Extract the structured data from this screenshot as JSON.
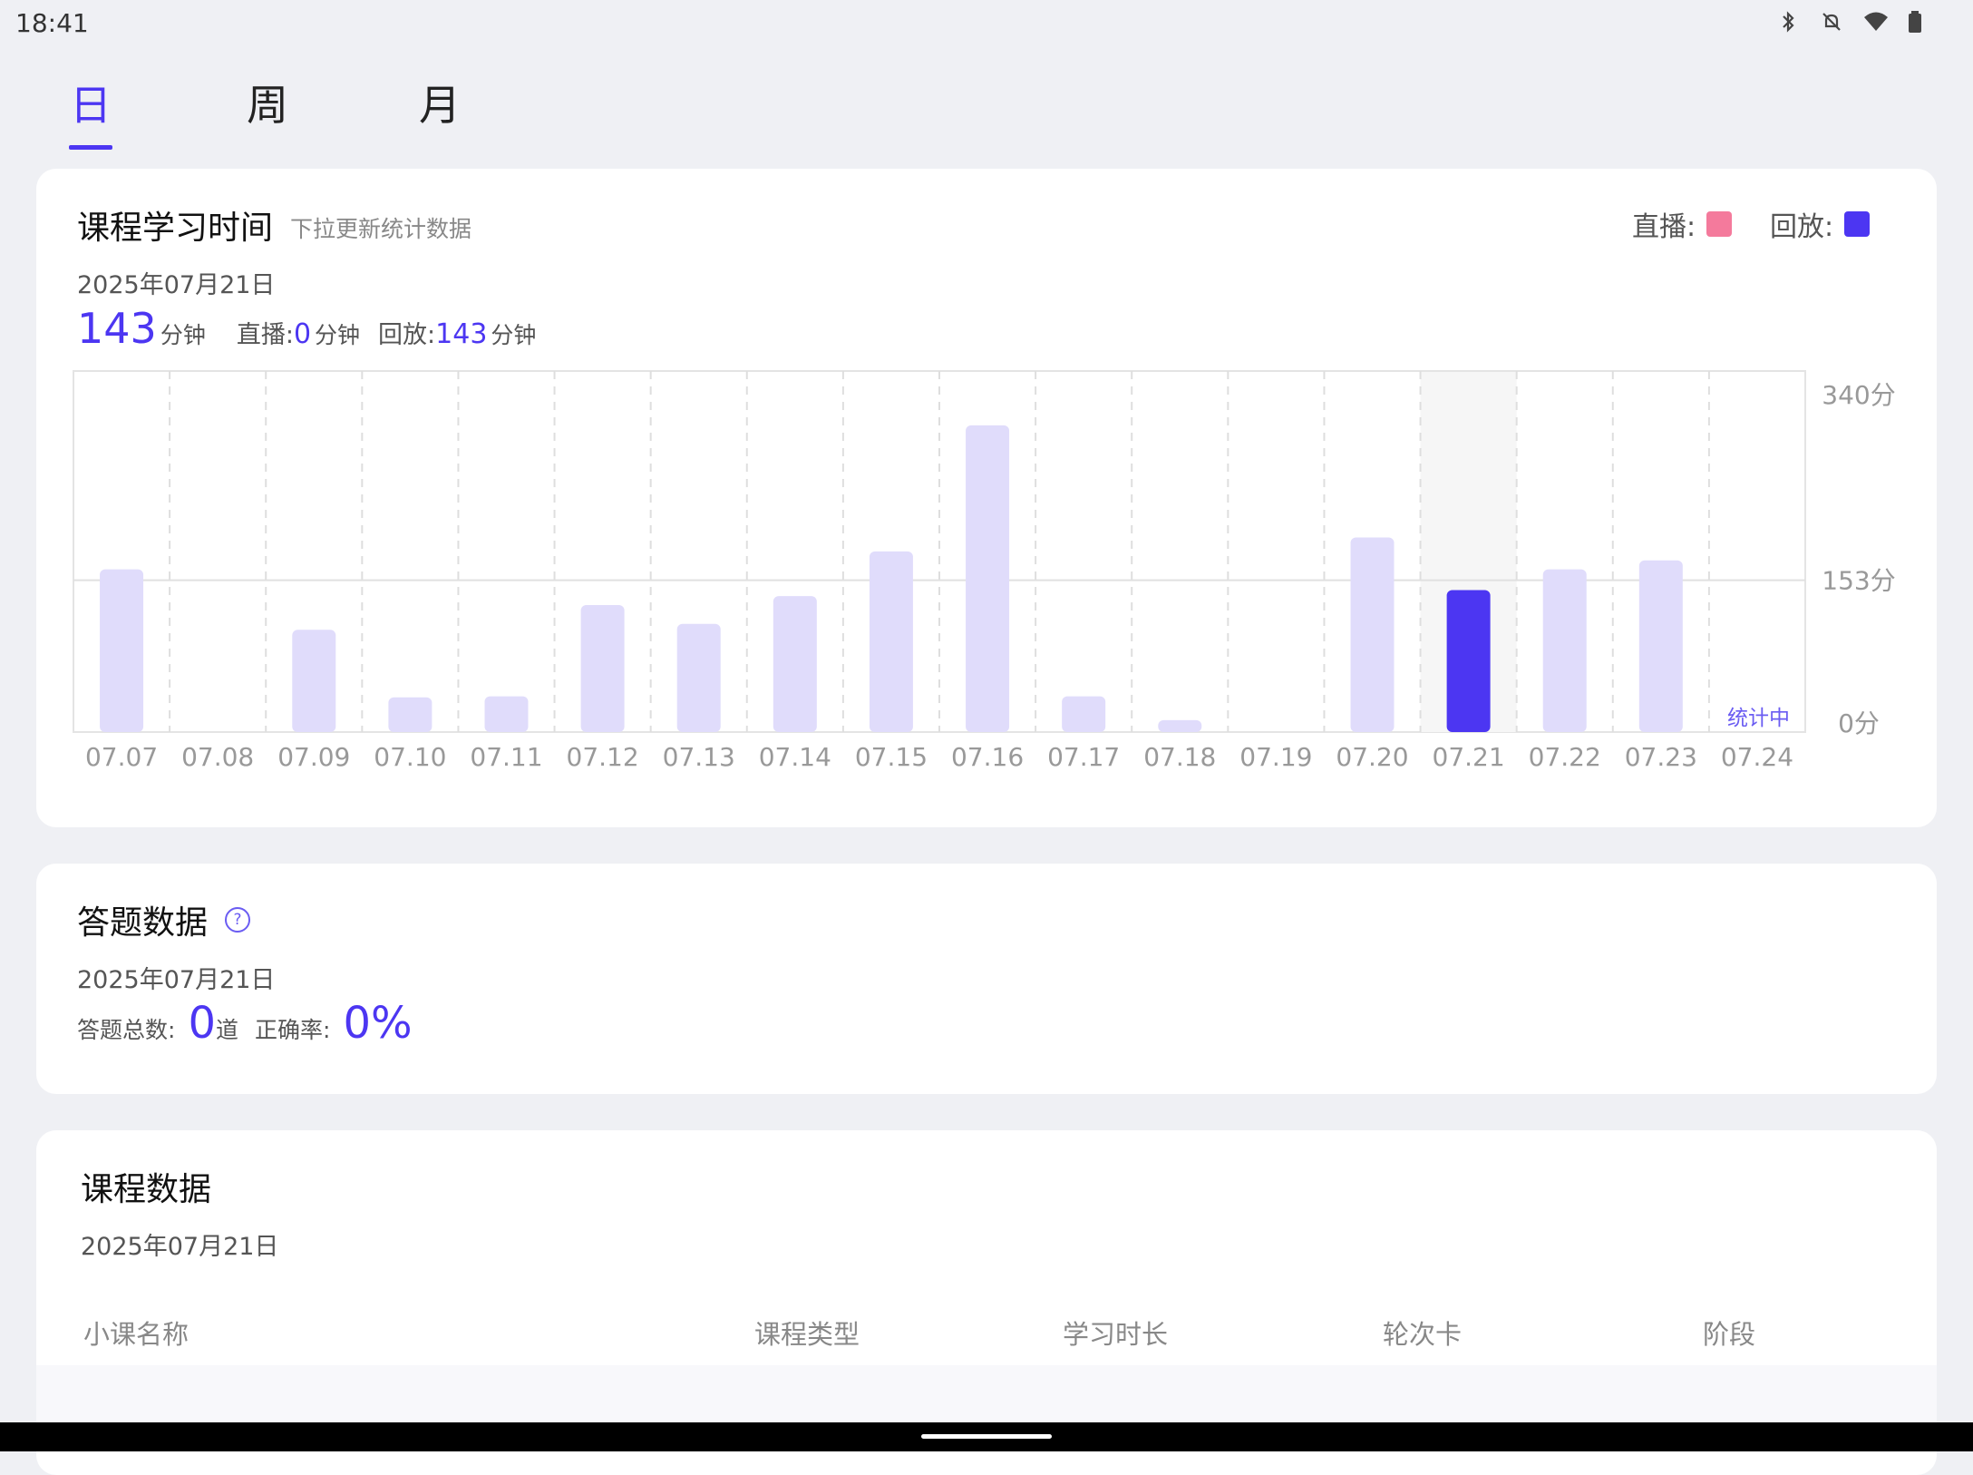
{
  "status": {
    "time": "18:41"
  },
  "tabs": [
    {
      "label": "日",
      "active": true
    },
    {
      "label": "周",
      "active": false
    },
    {
      "label": "月",
      "active": false
    }
  ],
  "study_card": {
    "title": "课程学习时间",
    "hint": "下拉更新统计数据",
    "date": "2025年07月21日",
    "legend": [
      {
        "label": "直播:",
        "color": "#f47a9c"
      },
      {
        "label": "回放:",
        "color": "#4c36f2"
      }
    ],
    "total": "143",
    "total_unit": "分钟",
    "live_label": "直播:",
    "live_value": "0",
    "live_unit": "分钟",
    "replay_label": "回放:",
    "replay_value": "143",
    "replay_unit": "分钟"
  },
  "chart_data": {
    "type": "bar",
    "categories": [
      "07.07",
      "07.08",
      "07.09",
      "07.10",
      "07.11",
      "07.12",
      "07.13",
      "07.14",
      "07.15",
      "07.16",
      "07.17",
      "07.18",
      "07.19",
      "07.20",
      "07.21",
      "07.22",
      "07.23",
      "07.24"
    ],
    "values": [
      164,
      0,
      103,
      35,
      36,
      128,
      109,
      137,
      182,
      309,
      36,
      12,
      0,
      196,
      143,
      164,
      173,
      0
    ],
    "selected_index": 14,
    "ylim": [
      0,
      340
    ],
    "yticks": [
      "340分",
      "153分",
      "0分"
    ],
    "ytick_values": [
      340,
      153,
      0
    ],
    "annotation": "统计中",
    "colors": {
      "normal": "#e0dcfb",
      "selected": "#4c36f2"
    }
  },
  "answer_card": {
    "title": "答题数据",
    "date": "2025年07月21日",
    "total_label": "答题总数:",
    "total_value": "0",
    "total_unit": "道",
    "rate_label": "正确率:",
    "rate_value": "0%"
  },
  "course_card": {
    "title": "课程数据",
    "date": "2025年07月21日",
    "columns": [
      "小课名称",
      "课程类型",
      "学习时长",
      "轮次卡",
      "阶段"
    ]
  }
}
